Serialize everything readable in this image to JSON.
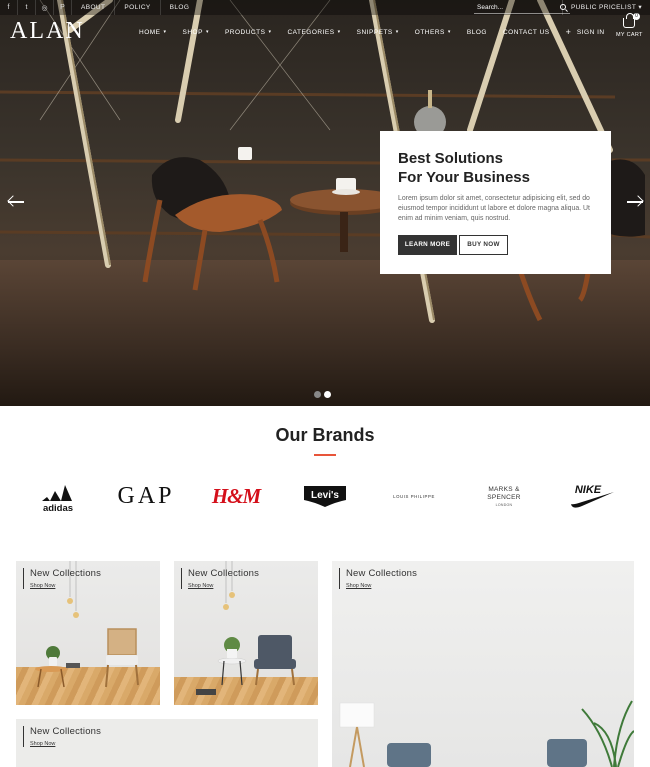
{
  "topbar": {
    "social": [
      "f",
      "t",
      "◎",
      "P"
    ],
    "links": [
      "ABOUT",
      "POLICY",
      "BLOG"
    ],
    "search_placeholder": "Search...",
    "pricelist": "PUBLIC PRICELIST"
  },
  "logo": "ALAN",
  "nav": {
    "items": [
      {
        "label": "HOME",
        "caret": "▾"
      },
      {
        "label": "SHOP",
        "caret": "▾"
      },
      {
        "label": "PRODUCTS",
        "caret": "▾"
      },
      {
        "label": "CATEGORIES",
        "caret": "▾"
      },
      {
        "label": "SNIPPETS",
        "caret": "▾"
      },
      {
        "label": "OTHERS",
        "caret": "▾"
      },
      {
        "label": "BLOG",
        "caret": ""
      },
      {
        "label": "CONTACT US",
        "caret": ""
      }
    ],
    "plus": "+",
    "signin": "SIGN IN"
  },
  "cart": {
    "count": "0",
    "label": "MY CART"
  },
  "hero": {
    "title_line1": "Best Solutions",
    "title_line2": "For Your Business",
    "text": "Lorem ipsum dolor sit amet, consectetur adipisicing elit, sed do eiusmod tempor incididunt ut labore et dolore magna aliqua. Ut enim ad minim veniam, quis nostrud.",
    "learn_more": "LEARN MORE",
    "buy_now": "BUY NOW",
    "active_slide": 2,
    "slide_count": 2
  },
  "brands": {
    "title": "Our Brands",
    "accent": "#e8553a",
    "items": [
      {
        "name": "adidas"
      },
      {
        "name": "GAP"
      },
      {
        "name": "H&M"
      },
      {
        "name": "Levi's"
      },
      {
        "name": "LOUIS PHILIPPE"
      },
      {
        "name": "MARKS & SPENCER",
        "sub": "LONDON"
      },
      {
        "name": "NIKE"
      }
    ]
  },
  "collections": [
    {
      "title": "New Collections",
      "link": "Shop Now"
    },
    {
      "title": "New Collections",
      "link": "Shop Now"
    },
    {
      "title": "New Collections",
      "link": "Shop Now"
    },
    {
      "title": "New Collections",
      "link": "Shop Now"
    }
  ]
}
